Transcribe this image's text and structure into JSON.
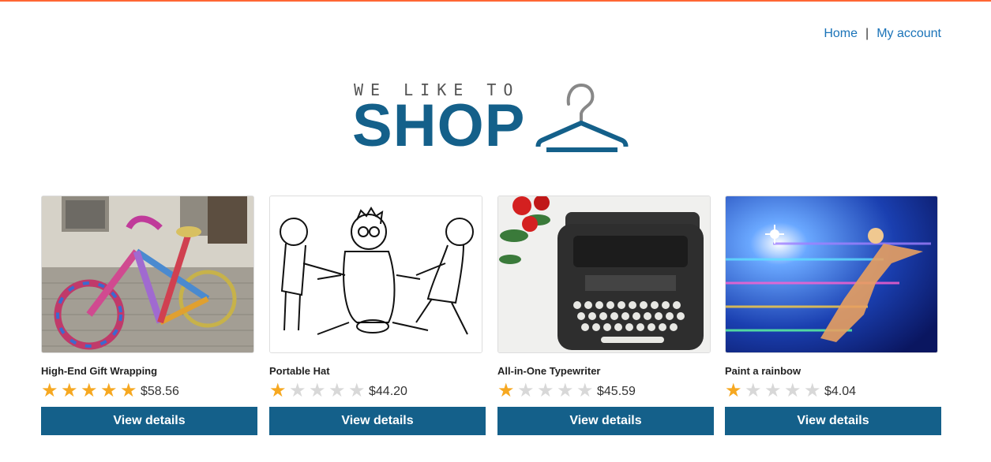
{
  "nav": {
    "home": "Home",
    "separator": "|",
    "account": "My account"
  },
  "logo": {
    "tagline": "WE LIKE TO",
    "word": "SHOP"
  },
  "colors": {
    "accent": "#ff6633",
    "brand": "#14608a",
    "star": "#f6a821"
  },
  "products": [
    {
      "name": "High-End Gift Wrapping",
      "rating": 5,
      "price": "$58.56",
      "button": "View details",
      "image": "yarn-bombed bicycle"
    },
    {
      "name": "Portable Hat",
      "rating": 1,
      "price": "$44.20",
      "button": "View details",
      "image": "cartoon of three men"
    },
    {
      "name": "All-in-One Typewriter",
      "rating": 1,
      "price": "$45.59",
      "button": "View details",
      "image": "typewriter with roses"
    },
    {
      "name": "Paint a rainbow",
      "rating": 1,
      "price": "$4.04",
      "button": "View details",
      "image": "colorful flying figure"
    }
  ]
}
